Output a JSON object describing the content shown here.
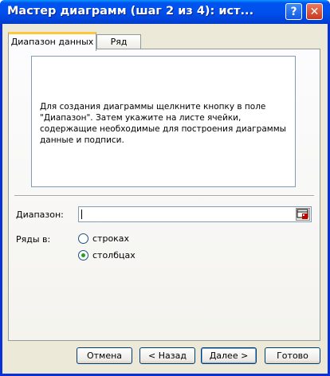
{
  "window": {
    "title": "Мастер диаграмм (шаг 2 из 4): ист...",
    "help_symbol": "?",
    "close_symbol": "✕",
    "titlebar_color": "#0054e3"
  },
  "tabs": [
    {
      "label": "Диапазон данных",
      "active": true
    },
    {
      "label": "Ряд",
      "active": false
    }
  ],
  "preview": {
    "message": "Для создания диаграммы щелкните кнопку в поле \"Диапазон\". Затем укажите на листе ячейки, содержащие необходимые для построения диаграммы данные и подписи."
  },
  "range": {
    "label": "Диапазон:",
    "value": "",
    "picker_icon": "range-picker-icon"
  },
  "series_in": {
    "label": "Ряды в:",
    "options": [
      {
        "label": "строках",
        "selected": false
      },
      {
        "label": "столбцах",
        "selected": true
      }
    ]
  },
  "buttons": {
    "cancel": "Отмена",
    "back": "< Назад",
    "next": "Далее >",
    "finish": "Готово"
  }
}
